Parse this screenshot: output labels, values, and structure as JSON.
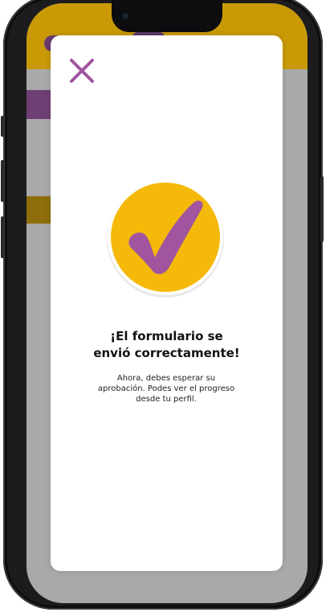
{
  "modal": {
    "title_line1": "¡El formulario se",
    "title_line2": "envió correctamente!",
    "message_line1": "Ahora, debes esperar su",
    "message_line2": "aprobación. Podes ver el progreso",
    "message_line3": "desde tu perfil."
  },
  "colors": {
    "accent_purple": "#a1559e",
    "accent_gold": "#f5b90a",
    "header_gold": "#c99a06",
    "overlay_gray": "#a9a9a9"
  },
  "icons": {
    "close": "close-icon",
    "success": "checkmark-icon"
  }
}
